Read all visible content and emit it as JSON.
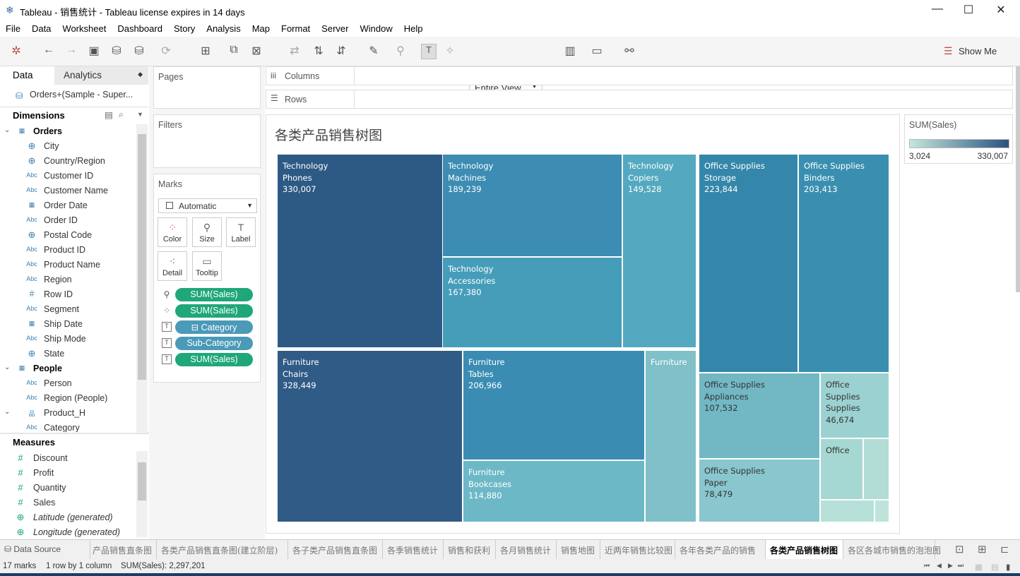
{
  "window": {
    "title": "Tableau - 销售统计 - Tableau license expires in 14 days",
    "minimize": "—",
    "maximize": "☐",
    "close": "✕"
  },
  "menu": [
    "File",
    "Data",
    "Worksheet",
    "Dashboard",
    "Story",
    "Analysis",
    "Map",
    "Format",
    "Server",
    "Window",
    "Help"
  ],
  "toolbar": {
    "fit": "Entire View",
    "show_me": "Show Me"
  },
  "sidebar": {
    "tab_data": "Data",
    "tab_analytics": "Analytics",
    "datasource": "Orders+(Sample - Super...",
    "dimensions_label": "Dimensions",
    "dimensions": [
      {
        "label": "Orders",
        "type": "table",
        "header": true
      },
      {
        "label": "City",
        "type": "geo"
      },
      {
        "label": "Country/Region",
        "type": "geo"
      },
      {
        "label": "Customer ID",
        "type": "abc"
      },
      {
        "label": "Customer Name",
        "type": "abc"
      },
      {
        "label": "Order Date",
        "type": "date"
      },
      {
        "label": "Order ID",
        "type": "abc"
      },
      {
        "label": "Postal Code",
        "type": "geo"
      },
      {
        "label": "Product ID",
        "type": "abc"
      },
      {
        "label": "Product Name",
        "type": "abc"
      },
      {
        "label": "Region",
        "type": "abc"
      },
      {
        "label": "Row ID",
        "type": "num"
      },
      {
        "label": "Segment",
        "type": "abc"
      },
      {
        "label": "Ship Date",
        "type": "date"
      },
      {
        "label": "Ship Mode",
        "type": "abc"
      },
      {
        "label": "State",
        "type": "geo"
      },
      {
        "label": "People",
        "type": "table",
        "header": true
      },
      {
        "label": "Person",
        "type": "abc"
      },
      {
        "label": "Region (People)",
        "type": "abc"
      },
      {
        "label": "Product_H",
        "type": "hier"
      },
      {
        "label": "Category",
        "type": "abc"
      }
    ],
    "measures_label": "Measures",
    "measures": [
      {
        "label": "Discount"
      },
      {
        "label": "Profit"
      },
      {
        "label": "Quantity"
      },
      {
        "label": "Sales"
      },
      {
        "label": "Latitude (generated)",
        "italic": true,
        "geo": true
      },
      {
        "label": "Longitude (generated)",
        "italic": true,
        "geo": true
      }
    ]
  },
  "cards": {
    "pages": "Pages",
    "filters": "Filters",
    "marks": "Marks",
    "mark_type": "Automatic",
    "mark_buttons": [
      "Color",
      "Size",
      "Label",
      "Detail",
      "Tooltip"
    ],
    "pills": [
      {
        "label": "SUM(Sales)",
        "color": "#1fa77a",
        "icon": "size"
      },
      {
        "label": "SUM(Sales)",
        "color": "#1fa77a",
        "icon": "color"
      },
      {
        "label": "⊟ Category",
        "color": "#4a9ab8",
        "icon": "T"
      },
      {
        "label": "Sub-Category",
        "color": "#4a9ab8",
        "icon": "T"
      },
      {
        "label": "SUM(Sales)",
        "color": "#1fa77a",
        "icon": "T"
      }
    ]
  },
  "shelves": {
    "columns": "Columns",
    "rows": "Rows"
  },
  "legend": {
    "title": "SUM(Sales)",
    "min": "3,024",
    "max": "330,007",
    "color_low": "#c4e6dc",
    "color_high": "#2a5480"
  },
  "chart_data": {
    "type": "treemap",
    "title": "各类产品销售树图",
    "cells": [
      {
        "category": "Technology",
        "subcategory": "Phones",
        "sales": "330,007"
      },
      {
        "category": "Technology",
        "subcategory": "Machines",
        "sales": "189,239"
      },
      {
        "category": "Technology",
        "subcategory": "Accessories",
        "sales": "167,380"
      },
      {
        "category": "Technology",
        "subcategory": "Copiers",
        "sales": "149,528"
      },
      {
        "category": "Furniture",
        "subcategory": "Chairs",
        "sales": "328,449"
      },
      {
        "category": "Furniture",
        "subcategory": "Tables",
        "sales": "206,966"
      },
      {
        "category": "Furniture",
        "subcategory": "Bookcases",
        "sales": "114,880"
      },
      {
        "category": "Furniture",
        "subcategory": "",
        "sales": ""
      },
      {
        "category": "Office Supplies",
        "subcategory": "Storage",
        "sales": "223,844"
      },
      {
        "category": "Office Supplies",
        "subcategory": "Binders",
        "sales": "203,413"
      },
      {
        "category": "Office Supplies",
        "subcategory": "Appliances",
        "sales": "107,532"
      },
      {
        "category": "Office Supplies",
        "subcategory": "Paper",
        "sales": "78,479"
      },
      {
        "category": "Office Supplies",
        "subcategory": "Supplies",
        "sales": "46,674"
      },
      {
        "category": "Office",
        "subcategory": "",
        "sales": ""
      },
      {
        "category": "",
        "subcategory": "",
        "sales": ""
      },
      {
        "category": "",
        "subcategory": "",
        "sales": ""
      },
      {
        "category": "",
        "subcategory": "",
        "sales": ""
      }
    ]
  },
  "tabs": {
    "data_source": "Data Source",
    "sheets": [
      "产品销售直条图",
      "各类产品销售直条图(建立阶层)",
      "各子类产品销售直条图",
      "各季销售统计",
      "销售和获利",
      "各月销售统计",
      "销售地图",
      "近两年销售比较图",
      "各年各类产品的销售",
      "各类产品销售树图",
      "各区各城市销售的泡泡图"
    ],
    "active": 9
  },
  "status": {
    "marks": "17 marks",
    "layout": "1 row by 1 column",
    "sum": "SUM(Sales): 2,297,201"
  }
}
